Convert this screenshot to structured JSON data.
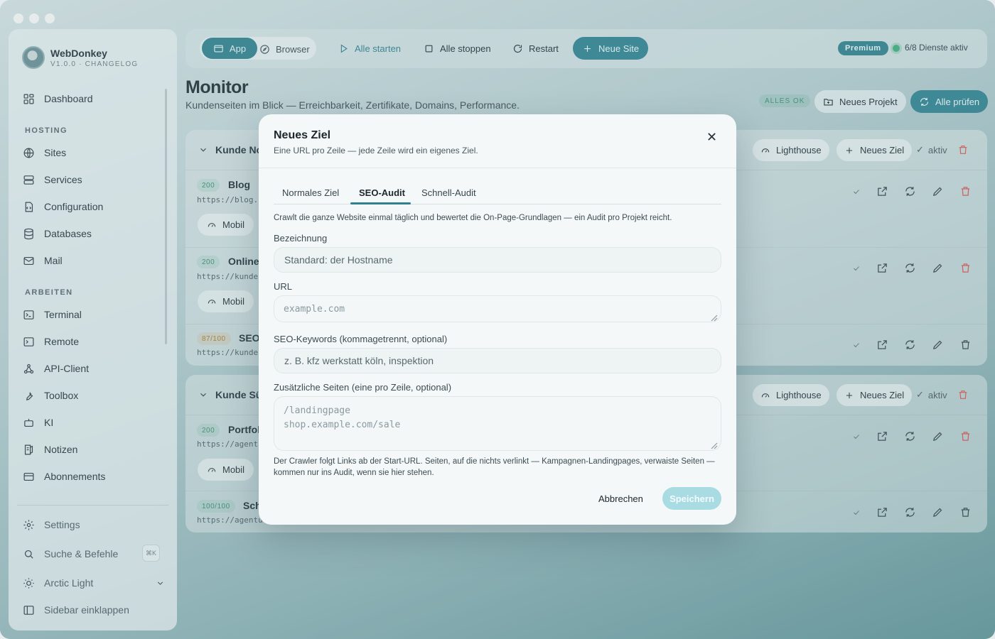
{
  "sidebar": {
    "brand_name": "WebDonkey",
    "brand_version": "V1.0.0 · CHANGELOG",
    "dashboard": "Dashboard",
    "section_hosting": "HOSTING",
    "hosting_items": [
      "Sites",
      "Services",
      "Configuration",
      "Databases",
      "Mail"
    ],
    "section_arbeiten": "ARBEITEN",
    "arbeiten_items": [
      "Terminal",
      "Remote",
      "API-Client",
      "Toolbox",
      "KI",
      "Notizen",
      "Abonnements"
    ],
    "settings": "Settings",
    "search": "Suche & Befehle",
    "search_shortcut": "⌘K",
    "theme": "Arctic Light",
    "collapse": "Sidebar einklappen"
  },
  "toolbar": {
    "app": "App",
    "browser": "Browser",
    "start_all": "Alle starten",
    "stop_all": "Alle stoppen",
    "restart": "Restart",
    "new_site": "Neue Site",
    "premium": "Premium",
    "services_status": "6/8 Dienste aktiv"
  },
  "page": {
    "title": "Monitor",
    "subtitle": "Kundenseiten im Blick — Erreichbarkeit, Zertifikate, Domains, Performance.",
    "status_badge": "ALLES OK",
    "new_project": "Neues Projekt",
    "check_all": "Alle prüfen"
  },
  "projects": [
    {
      "name": "Kunde No",
      "lighthouse": "Lighthouse",
      "new_target": "Neues Ziel",
      "status": "aktiv",
      "rows": [
        {
          "code": "200",
          "name": "Blog",
          "url": "https://blog.",
          "mobile": "Mobil"
        },
        {
          "code": "200",
          "name": "Online",
          "url": "https://kunde",
          "mobile": "Mobil"
        },
        {
          "code": "87/100",
          "name": "SEO",
          "url": "https://kunde"
        }
      ]
    },
    {
      "name": "Kunde Sü",
      "lighthouse": "Lighthouse",
      "new_target": "Neues Ziel",
      "status": "aktiv",
      "rows": [
        {
          "code": "200",
          "name": "Portfol",
          "url": "https://agent",
          "mobile": "Mobil"
        },
        {
          "code": "100/100",
          "name": "Sch",
          "url": "https://agentu"
        }
      ]
    }
  ],
  "modal": {
    "title": "Neues Ziel",
    "subtitle": "Eine URL pro Zeile — jede Zeile wird ein eigenes Ziel.",
    "tabs": [
      "Normales Ziel",
      "SEO-Audit",
      "Schnell-Audit"
    ],
    "active_tab": "SEO-Audit",
    "description": "Crawlt die ganze Website einmal täglich und bewertet die On-Page-Grundlagen — ein Audit pro Projekt reicht.",
    "label_name": "Bezeichnung",
    "placeholder_name": "Standard: der Hostname",
    "label_url": "URL",
    "placeholder_url": "example.com",
    "label_keywords": "SEO-Keywords (kommagetrennt, optional)",
    "placeholder_keywords": "z. B. kfz werkstatt köln, inspektion",
    "label_pages": "Zusätzliche Seiten (eine pro Zeile, optional)",
    "placeholder_pages": "/landingpage\nshop.example.com/sale",
    "hint": "Der Crawler folgt Links ab der Start-URL. Seiten, auf die nichts verlinkt — Kampagnen-Landingpages, verwaiste Seiten — kommen nur ins Audit, wenn sie hier stehen.",
    "cancel": "Abbrechen",
    "save": "Speichern"
  },
  "colors": {
    "accent": "#2f8190",
    "save_disabled": "#a9dbe3",
    "danger": "#d9534f",
    "ok": "#3fae7a"
  }
}
